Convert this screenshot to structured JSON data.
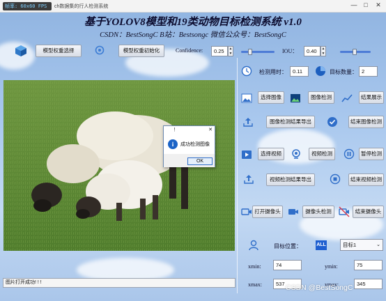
{
  "window": {
    "fps_label": "帧率: 60x60 FPS",
    "title": "ch数据集的行人检测系统",
    "controls": [
      "—",
      "□",
      "✕"
    ]
  },
  "header": {
    "title": "基于YOLOV8模型和19类动物目标检测系统 v1.0",
    "subtitle": "CSDN：BestSongC   B站：Bestsongc   微信公众号：BestSongC"
  },
  "toolbar": {
    "select_model_label": "模型权重选择",
    "init_model_label": "模型权重初始化",
    "confidence_label": "Confidence:",
    "confidence_value": "0.25",
    "iou_label": "IOU：",
    "iou_value": "0.40",
    "confidence_slider": 0.25,
    "iou_slider": 0.4
  },
  "stats": {
    "time_label": "检测用时：",
    "time_value": "0.11",
    "count_label": "目标数量：",
    "count_value": "2"
  },
  "image_section": {
    "select_label": "选择图像",
    "detect_label": "图像检测",
    "show_label": "结果展示",
    "export_label": "图像检测结果导出",
    "end_label": "结束图像检测"
  },
  "video_section": {
    "select_label": "选择视频",
    "detect_label": "视频检测",
    "pause_label": "暂停检测",
    "export_label": "视频检测结果导出",
    "end_label": "结束视频检测"
  },
  "camera_section": {
    "open_label": "打开摄像头",
    "detect_label": "摄像头检测",
    "end_label": "结束摄像头"
  },
  "target": {
    "position_label": "目标位置：",
    "all_badge": "ALL",
    "selected": "目标1",
    "xmin_label": "xmin:",
    "xmin_value": "74",
    "ymin_label": "ymin:",
    "ymin_value": "75",
    "xmax_label": "xmax:",
    "xmax_value": "537",
    "ymax_label": "ymax:",
    "ymax_value": "345"
  },
  "status_bar": "图片打开成功! ! !",
  "dialog": {
    "title": "！",
    "message": "成功检测图像",
    "ok_label": "OK"
  },
  "watermark": "CSDN @BestSongC",
  "colors": {
    "accent": "#2f6ec9",
    "title_text": "#0b0b2e",
    "grass": "#5f8c34"
  }
}
